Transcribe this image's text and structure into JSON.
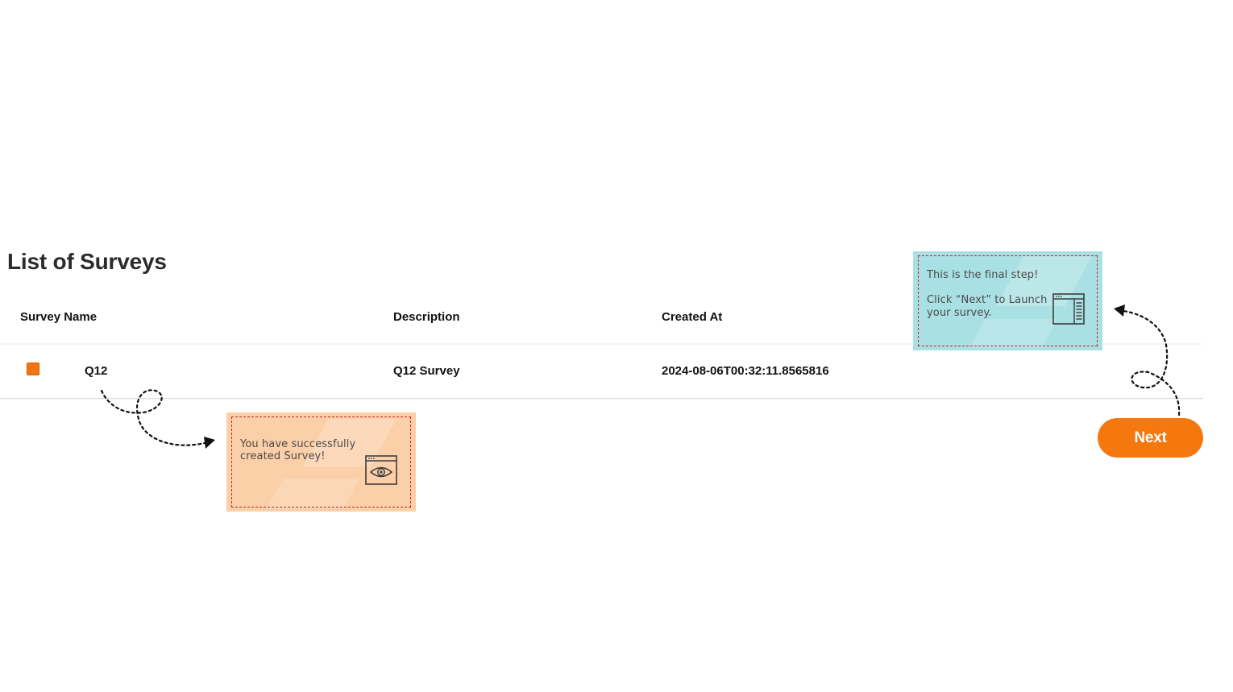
{
  "page": {
    "title": "List of Surveys"
  },
  "table": {
    "columns": [
      "Survey Name",
      "Description",
      "Created At"
    ],
    "rows": [
      {
        "name": "Q12",
        "description": "Q12 Survey",
        "created_at": "2024-08-06T00:32:11.8565816",
        "selected": true
      }
    ]
  },
  "actions": {
    "next_label": "Next"
  },
  "tooltips": {
    "success": {
      "text": "You have successfully created Survey!",
      "line1": "You have successfully",
      "line2": "created Survey!",
      "icon": "browser-eye-icon",
      "color": "#fbcfa8"
    },
    "final_step": {
      "line1": "This is the final step!",
      "line2": "Click “Next” to Launch",
      "line3": "your survey.",
      "icon": "browser-window-icon",
      "color": "#a9e0e3"
    }
  },
  "colors": {
    "accent": "#f5780f",
    "dash_border": "#c2272d"
  }
}
